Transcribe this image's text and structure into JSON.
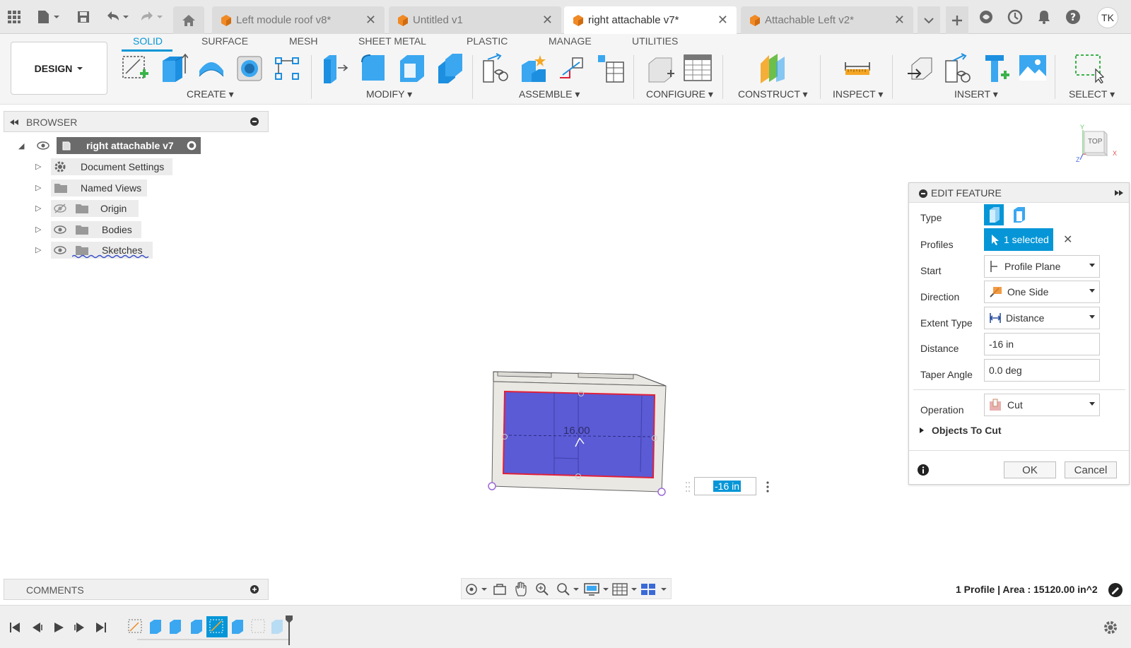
{
  "topbar": {
    "tabs": [
      {
        "label": "Left module roof v8*",
        "active": false
      },
      {
        "label": "Untitled v1",
        "active": false
      },
      {
        "label": "right attachable v7*",
        "active": true
      },
      {
        "label": "Attachable Left v2*",
        "active": false
      }
    ],
    "close_glyph": "✕",
    "user_initials": "TK"
  },
  "ribbon": {
    "workspace_button": "DESIGN",
    "tabs": [
      "SOLID",
      "SURFACE",
      "MESH",
      "SHEET METAL",
      "PLASTIC",
      "MANAGE",
      "UTILITIES"
    ],
    "active_tab": "SOLID",
    "groups": [
      "CREATE",
      "MODIFY",
      "ASSEMBLE",
      "CONFIGURE",
      "CONSTRUCT",
      "INSPECT",
      "INSERT",
      "SELECT"
    ]
  },
  "browser": {
    "title": "BROWSER",
    "root_label": "right attachable v7",
    "items": [
      "Document Settings",
      "Named Views",
      "Origin",
      "Bodies",
      "Sketches"
    ]
  },
  "viewcube": {
    "label": "TOP",
    "axis_y": "Y",
    "axis_z": "Z",
    "axis_x": "X"
  },
  "viewport": {
    "sketch_dimension": "16.00",
    "dimension_input": "-16 in"
  },
  "edit_feature": {
    "title": "EDIT FEATURE",
    "type_label": "Type",
    "profiles_label": "Profiles",
    "profiles_value": "1 selected",
    "start_label": "Start",
    "start_value": "Profile Plane",
    "direction_label": "Direction",
    "direction_value": "One Side",
    "extent_label": "Extent Type",
    "extent_value": "Distance",
    "distance_label": "Distance",
    "distance_value": "-16 in",
    "taper_label": "Taper Angle",
    "taper_value": "0.0 deg",
    "operation_label": "Operation",
    "operation_value": "Cut",
    "objects_label": "Objects To Cut",
    "ok_label": "OK",
    "cancel_label": "Cancel",
    "clear_glyph": "✕"
  },
  "comments": {
    "title": "COMMENTS"
  },
  "status": {
    "text": "1 Profile | Area : 15120.00 in^2"
  },
  "colors": {
    "accent": "#0696d7",
    "selection_fill": "#5b5bd6",
    "selection_outline": "#e0203a",
    "body": "#eae8e3"
  }
}
